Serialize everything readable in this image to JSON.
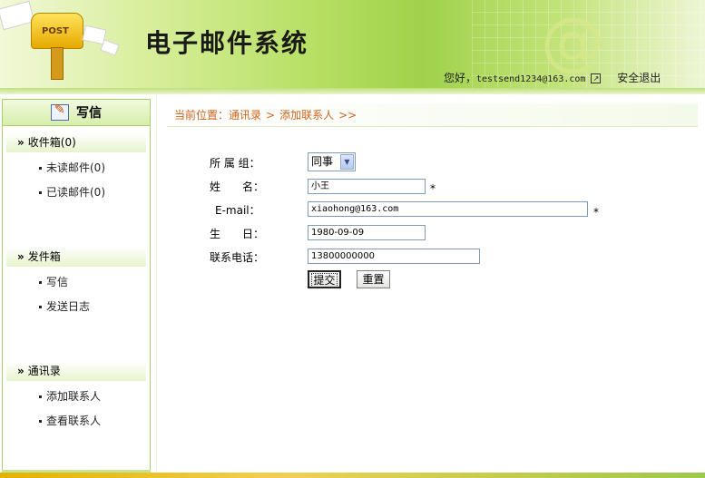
{
  "header": {
    "app_title": "电子邮件系统",
    "logo_text": "POST",
    "greeting": "您好，",
    "user_email": "testsend1234@163.com",
    "logout": "安全退出"
  },
  "sidebar": {
    "compose": "写信",
    "inbox": {
      "title": "收件箱(0)",
      "items": [
        "未读邮件(0)",
        "已读邮件(0)"
      ]
    },
    "outbox": {
      "title": "发件箱",
      "items": [
        "写信",
        "发送日志"
      ]
    },
    "contacts": {
      "title": "通讯录",
      "items": [
        "添加联系人",
        "查看联系人"
      ]
    }
  },
  "breadcrumb": {
    "prefix": "当前位置：",
    "level1": "通讯录",
    "separator": ">",
    "level2": "添加联系人",
    "trail": ">>"
  },
  "form": {
    "group_label": "所 属 组：",
    "group_value": "同事",
    "name_label": "姓　　名：",
    "name_value": "小王",
    "email_label": "E-mail：",
    "email_value": "xiaohong@163.com",
    "birthday_label": "生　　日：",
    "birthday_value": "1980-09-09",
    "phone_label": "联系电话：",
    "phone_value": "13800000000",
    "required_mark": "*",
    "submit_label": "提交",
    "reset_label": "重置"
  }
}
